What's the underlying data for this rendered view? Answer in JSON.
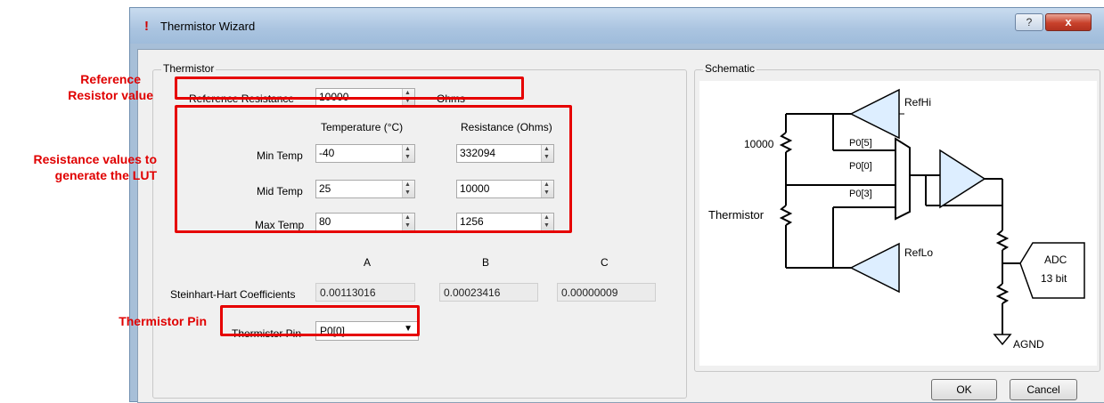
{
  "window": {
    "title": "Thermistor Wizard",
    "title_icon": "red-exclamation-icon",
    "help_button": "?",
    "close_button": "x"
  },
  "thermistor_group": {
    "label": "Thermistor",
    "reference_resistance": {
      "label": "Reference Resistance",
      "value": "10000",
      "unit": "Ohms"
    },
    "columns": {
      "temperature": "Temperature (°C)",
      "resistance": "Resistance (Ohms)"
    },
    "rows": [
      {
        "label": "Min Temp",
        "temperature": "-40",
        "resistance": "332094"
      },
      {
        "label": "Mid Temp",
        "temperature": "25",
        "resistance": "10000"
      },
      {
        "label": "Max Temp",
        "temperature": "80",
        "resistance": "1256"
      }
    ],
    "coefficients": {
      "label": "Steinhart-Hart Coefficients",
      "headers": [
        "A",
        "B",
        "C"
      ],
      "values": [
        "0.00113016",
        "0.00023416",
        "0.00000009"
      ]
    },
    "pin": {
      "label": "Thermistor Pin",
      "value": "P0[0]"
    }
  },
  "schematic_group": {
    "label": "Schematic",
    "labels": {
      "refhi": "RefHi",
      "reflo": "RefLo",
      "resistor": "10000",
      "thermistor": "Thermistor",
      "p05": "P0[5]",
      "p00": "P0[0]",
      "p03": "P0[3]",
      "adc": "ADC",
      "adc_bits": "13 bit",
      "agnd": "AGND"
    }
  },
  "buttons": {
    "ok": "OK",
    "cancel": "Cancel"
  },
  "annotations": {
    "reference_1": "Reference",
    "reference_2": "Resistor value",
    "resistance_1": "Resistance values to",
    "resistance_2": "generate the LUT",
    "pin": "Thermistor Pin"
  },
  "colors": {
    "annotation": "#e00000",
    "titlebar": "#aac4e0"
  }
}
